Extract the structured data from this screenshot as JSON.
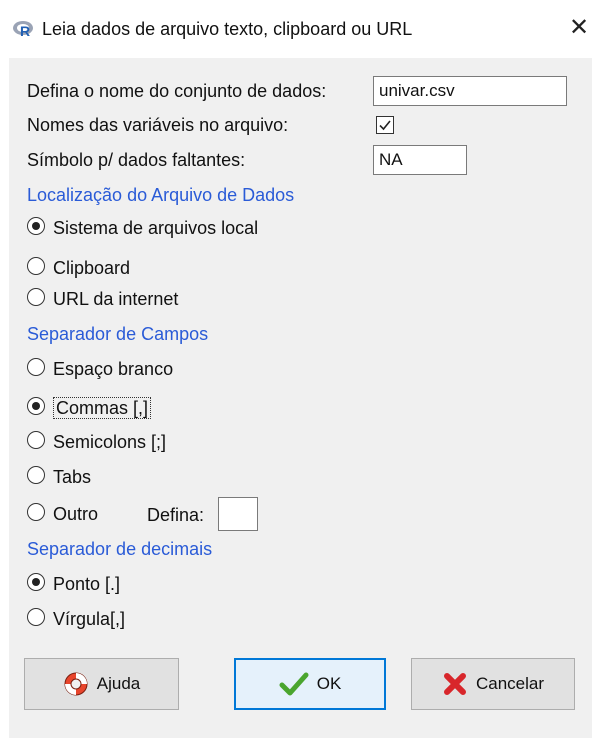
{
  "window": {
    "title": "Leia dados de arquivo texto, clipboard ou URL",
    "close_glyph": "✕"
  },
  "form": {
    "dataset_name_label": "Defina o nome do conjunto de dados:",
    "dataset_name_value": "univar.csv",
    "var_names_label": "Nomes das variáveis no arquivo:",
    "var_names_checked": true,
    "missing_label": "Símbolo p/ dados faltantes:",
    "missing_value": "NA"
  },
  "location": {
    "heading": "Localização do Arquivo de Dados",
    "options": [
      {
        "label": "Sistema de arquivos local",
        "selected": true
      },
      {
        "label": "Clipboard",
        "selected": false
      },
      {
        "label": "URL da internet",
        "selected": false
      }
    ]
  },
  "field_sep": {
    "heading": "Separador de Campos",
    "options": [
      {
        "label": "Espaço branco",
        "selected": false
      },
      {
        "label": "Commas [,]",
        "selected": true
      },
      {
        "label": "Semicolons [;]",
        "selected": false
      },
      {
        "label": "Tabs",
        "selected": false
      },
      {
        "label": "Outro",
        "selected": false
      }
    ],
    "other_define_label": "Defina:",
    "other_define_value": ""
  },
  "decimal_sep": {
    "heading": "Separador de decimais",
    "options": [
      {
        "label": "Ponto [.]",
        "selected": true
      },
      {
        "label": "Vírgula[,]",
        "selected": false
      }
    ]
  },
  "buttons": {
    "help": "Ajuda",
    "ok": "OK",
    "cancel": "Cancelar"
  },
  "colors": {
    "section_heading": "#2a5bd7",
    "dialog_bg": "#f0f0f0",
    "default_button_border": "#0078d7"
  },
  "icons": {
    "app": "r-logo-icon",
    "help": "lifebuoy-icon",
    "ok": "checkmark-icon",
    "cancel": "red-x-icon"
  }
}
